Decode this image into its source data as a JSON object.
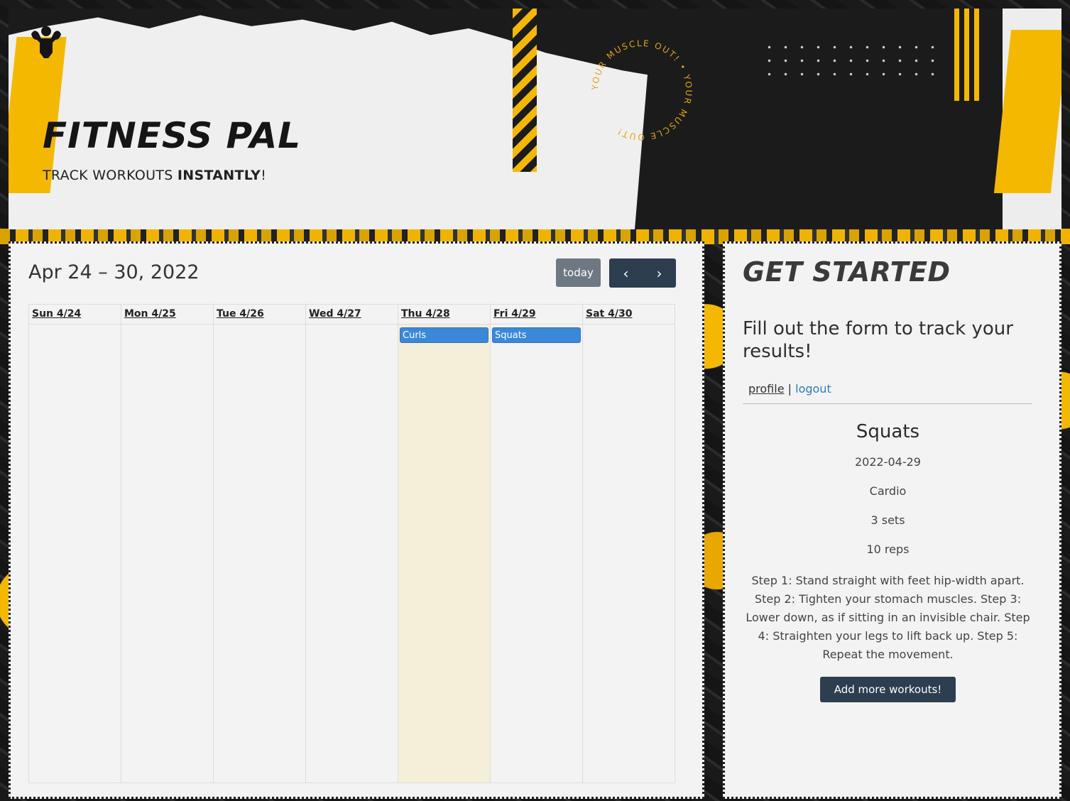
{
  "banner": {
    "title": "FITNESS PAL",
    "tagline_pre": "TRACK WORKOUTS ",
    "tagline_bold": "INSTANTLY",
    "tagline_post": "!",
    "circle_text": "YOUR MUSCLE OUT! • YOUR MUSCLE OUT!",
    "accent_color": "#f5b800"
  },
  "calendar": {
    "title": "Apr 24 – 30, 2022",
    "today_label": "today",
    "prev_label": "‹",
    "next_label": "›",
    "days": [
      {
        "label": "Sun 4/24",
        "today": false,
        "event": ""
      },
      {
        "label": "Mon 4/25",
        "today": false,
        "event": ""
      },
      {
        "label": "Tue 4/26",
        "today": false,
        "event": ""
      },
      {
        "label": "Wed 4/27",
        "today": false,
        "event": ""
      },
      {
        "label": "Thu 4/28",
        "today": true,
        "event": "Curls"
      },
      {
        "label": "Fri 4/29",
        "today": false,
        "event": "Squats"
      },
      {
        "label": "Sat 4/30",
        "today": false,
        "event": ""
      }
    ]
  },
  "sidebar": {
    "heading": "GET STARTED",
    "subheading": "Fill out the form to track your results!",
    "profile_link": "profile",
    "separator": "|",
    "logout_link": "logout",
    "workout": {
      "name": "Squats",
      "date": "2022-04-29",
      "type": "Cardio",
      "sets": "3 sets",
      "reps": "10 reps",
      "description": "Step 1: Stand straight with feet hip-width apart. Step 2: Tighten your stomach muscles. Step 3: Lower down, as if sitting in an invisible chair. Step 4: Straighten your legs to lift back up. Step 5: Repeat the movement."
    },
    "add_button": "Add more workouts!"
  }
}
